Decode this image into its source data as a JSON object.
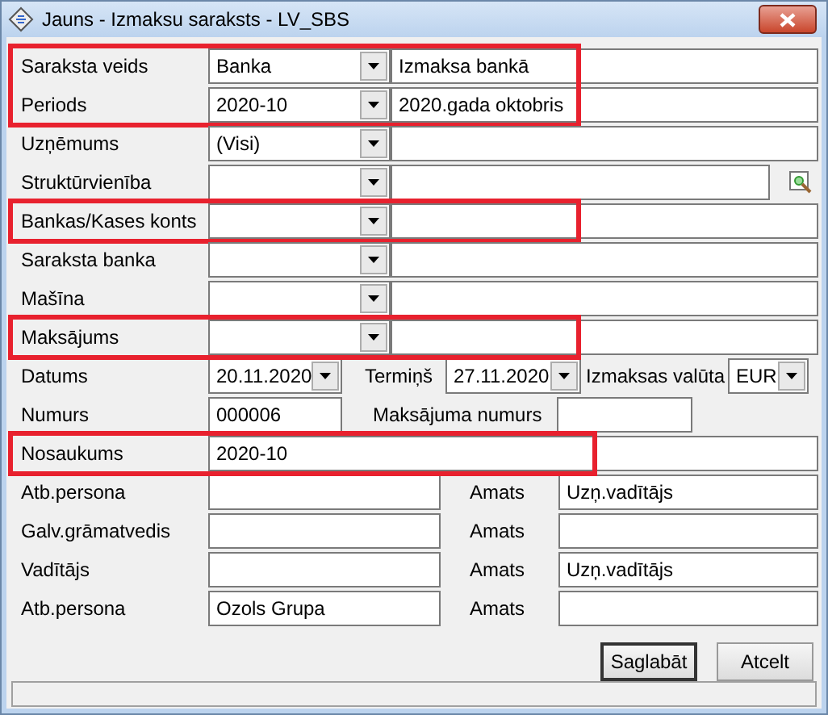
{
  "window": {
    "title": "Jauns - Izmaksu saraksts - LV_SBS"
  },
  "combo_rows": [
    {
      "label": "Saraksta veids",
      "value": "Banka",
      "description": "Izmaksa bankā",
      "highlighted": true,
      "lookup_button": false
    },
    {
      "label": "Periods",
      "value": "2020-10",
      "description": "2020.gada oktobris",
      "highlighted": true,
      "lookup_button": false
    },
    {
      "label": "Uzņēmums",
      "value": "(Visi)",
      "highlighted": false,
      "lookup_button": false
    },
    {
      "label": "Struktūrvienība",
      "highlighted": false,
      "lookup_button": true
    },
    {
      "label": "Bankas/Kases konts",
      "highlighted": true,
      "lookup_button": false
    },
    {
      "label": "Saraksta banka",
      "highlighted": false,
      "lookup_button": false
    },
    {
      "label": "Mašīna",
      "highlighted": false,
      "lookup_button": false
    },
    {
      "label": "Maksājums",
      "highlighted": true,
      "lookup_button": false
    }
  ],
  "date_row": {
    "date_label": "Datums",
    "date": "20.11.2020",
    "term_label": "Termiņš",
    "term": "27.11.2020",
    "currency_label": "Izmaksas valūta",
    "currency": "EUR"
  },
  "number_row": {
    "label": "Numurs",
    "value": "000006",
    "payment_label": "Maksājuma numurs"
  },
  "name_row": {
    "label": "Nosaukums",
    "value": "2020-10",
    "highlighted": true
  },
  "person_rows": [
    {
      "label": "Atb.persona",
      "position_label": "Amats",
      "position": "Uzņ.vadītājs"
    },
    {
      "label": "Galv.grāmatvedis",
      "position_label": "Amats"
    },
    {
      "label": "Vadītājs",
      "position_label": "Amats",
      "position": "Uzņ.vadītājs"
    },
    {
      "label": "Atb.persona",
      "name": "Ozols Grupa",
      "position_label": "Amats"
    }
  ],
  "buttons": [
    "Saglabāt",
    "Atcelt"
  ]
}
